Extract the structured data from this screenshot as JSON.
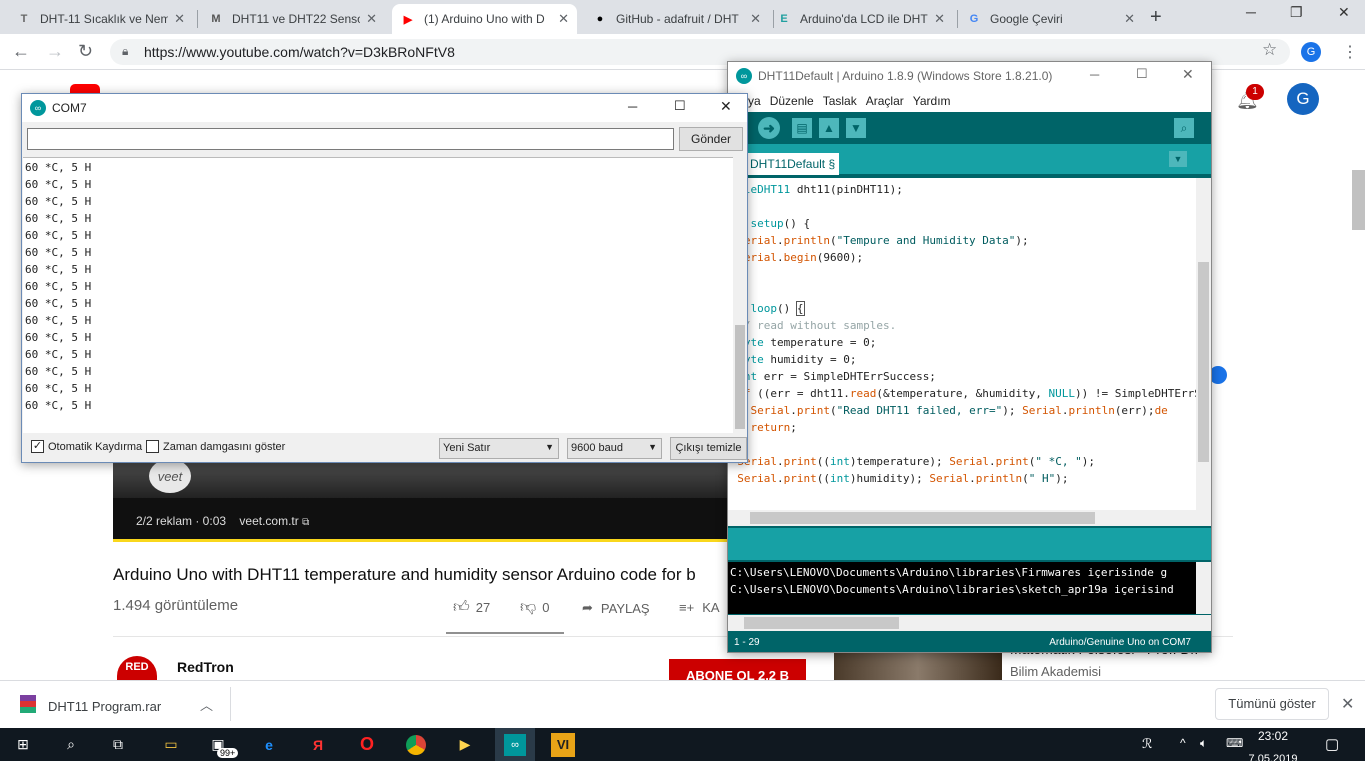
{
  "browser": {
    "tabs": [
      {
        "icon": "T",
        "label": "DHT-11 Sıcaklık ve Nem",
        "active": false
      },
      {
        "icon": "M",
        "label": "DHT11 ve DHT22 Senso",
        "active": false
      },
      {
        "icon": "▶",
        "label": "(1) Arduino Uno with D",
        "active": true
      },
      {
        "icon": "●",
        "label": "GitHub - adafruit / DHT",
        "active": false
      },
      {
        "icon": "E",
        "label": "Arduino'da LCD ile DHT",
        "active": false
      },
      {
        "icon": "G",
        "label": "Google Çeviri",
        "active": false
      }
    ],
    "new_tab": "+",
    "url": "https://www.youtube.com/watch?v=D3kBRoNFtV8",
    "profile_letter": "G"
  },
  "youtube": {
    "notification_count": "1",
    "avatar_letter": "G",
    "ad_text": "2/2 reklam · 0:03",
    "ad_link": "veet.com.tr",
    "ad_brand": "veet",
    "video_title": "Arduino Uno with DHT11 temperature and humidity sensor Arduino code for b",
    "views": "1.494 görüntüleme",
    "likes": "27",
    "dislikes": "0",
    "share": "PAYLAŞ",
    "save": "KA",
    "channel": "RedTron",
    "channel_logo": "RED",
    "subscribe": "ABONE OL  2,2 B",
    "side_video_title": "Matematik Felsefesi - Prof. Dr.",
    "side_channel": "Bilim Akademisi"
  },
  "serial_monitor": {
    "title": "COM7",
    "input_value": "",
    "send_label": "Gönder",
    "lines": [
      "60 *C, 5 H",
      "60 *C, 5 H",
      "60 *C, 5 H",
      "60 *C, 5 H",
      "60 *C, 5 H",
      "60 *C, 5 H",
      "60 *C, 5 H",
      "60 *C, 5 H",
      "60 *C, 5 H",
      "60 *C, 5 H",
      "60 *C, 5 H",
      "60 *C, 5 H",
      "60 *C, 5 H",
      "60 *C, 5 H",
      "60 *C, 5 H"
    ],
    "autoscroll_label": "Otomatik Kaydırma",
    "autoscroll_checked": true,
    "timestamp_label": "Zaman damgasını göster",
    "timestamp_checked": false,
    "line_ending": "Yeni Satır",
    "baud": "9600 baud",
    "clear_label": "Çıkışı temizle"
  },
  "ide": {
    "title": "DHT11Default | Arduino 1.8.9 (Windows Store 1.8.21.0)",
    "menu": [
      "ya",
      "Düzenle",
      "Taslak",
      "Araçlar",
      "Yardım"
    ],
    "tab_label": "DHT11Default §",
    "console_lines": [
      "C:\\Users\\LENOVO\\Documents\\Arduino\\libraries\\Firmwares içerisinde g",
      "C:\\Users\\LENOVO\\Documents\\Arduino\\libraries\\sketch_apr19a içerisind"
    ],
    "status_left": "1 - 29",
    "status_right": "Arduino/Genuine Uno on COM7"
  },
  "download": {
    "file": "DHT11 Program.rar",
    "show_all": "Tümünü göster"
  },
  "taskbar": {
    "badge": "99+",
    "time": "23:02",
    "date": "7.05.2019"
  }
}
